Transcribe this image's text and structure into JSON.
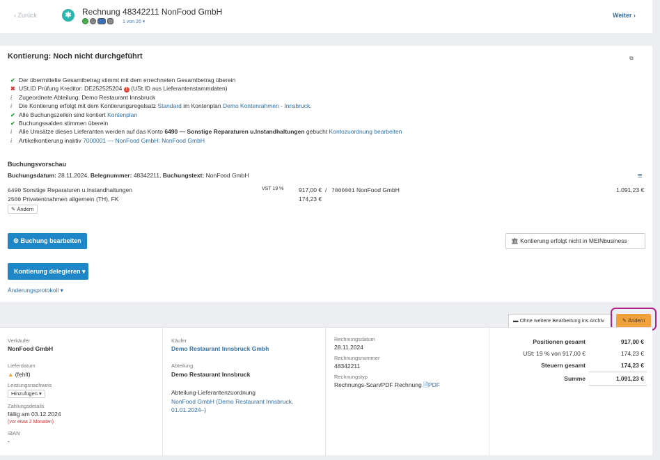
{
  "header": {
    "back_label": "‹ Zurück",
    "title": "Rechnung 48342211 NonFood GmbH",
    "counter": "1 von 26 ▾",
    "next_label": "Weiter ›"
  },
  "kontierung": {
    "title": "Kontierung: Noch nicht durchgeführt",
    "checks": [
      {
        "icon": "✔",
        "type": "ok",
        "text": "Der übermittelte Gesamtbetrag stimmt mit dem errechneten Gesamtbetrag überein"
      },
      {
        "icon": "✖",
        "type": "err",
        "text_a": "USt.ID Prüfung Kreditor: DE252525204",
        "text_b": "(USt.ID aus Lieferantenstammdaten)"
      },
      {
        "icon": "i",
        "type": "info",
        "text": "Zugeordnete Abteilung: Demo Restaurant Innsbruck"
      },
      {
        "icon": "i",
        "type": "info",
        "text_a": "Die Kontierung erfolgt mit dem Kontierungsregelsatz",
        "link_a": "Standard",
        "text_b": "im Kontenplan",
        "link_b": "Demo Kontenrahmen - Innsbruck",
        "text_c": "."
      },
      {
        "icon": "✔",
        "type": "ok",
        "text_a": "Alle Buchungszeilen sind kontiert",
        "link_a": "Kontenplan"
      },
      {
        "icon": "✔",
        "type": "ok",
        "text": "Buchungssalden stimmen überein"
      },
      {
        "icon": "i",
        "type": "info",
        "text_a": "Alle Umsätze dieses Lieferanten werden auf das Konto",
        "bold": "6490 — Sonstige Reparaturen u.Instandhaltungen",
        "text_b": "gebucht",
        "link_a": "Kontozuordnung bearbeiten"
      },
      {
        "icon": "i",
        "type": "info",
        "text_a": "Artikelkontierung inaktiv",
        "link_a": "7000001 — NonFood GmbH: NonFood GmbH"
      }
    ],
    "vorschau_title": "Buchungsvorschau",
    "meta": {
      "datum_label": "Buchungsdatum:",
      "datum": "28.11.2024,",
      "beleg_label": "Belegnummer:",
      "beleg": "48342211,",
      "text_label": "Buchungstext:",
      "text": "NonFood GmbH"
    },
    "rows": [
      {
        "konto": "6490",
        "name": "Sonstige Reparaturen u.Instandhaltungen",
        "vst": "VST 19 %",
        "betrag": "917,00 €",
        "sep": "/",
        "gegen_konto": "7000001",
        "gegen_name": "NonFood GmbH",
        "summe": "1.091,23 €"
      },
      {
        "konto": "2500",
        "name": "Privatentnahmen allgemein (TH), FK",
        "betrag": "174,23 €"
      }
    ],
    "aendern_small": "✎ Ändern",
    "btn_bearbeiten": "Buchung bearbeiten",
    "btn_mein": "Kontierung erfolgt nicht in MEINbusiness",
    "btn_delegieren": "Kontierung delegieren ▾",
    "protokoll": "Änderungsprotokoll ▾"
  },
  "actions": {
    "archiv": "Ohne weitere Bearbeitung ins Archiv",
    "aendern": "✎ Ändern"
  },
  "details": {
    "verkaeufer_label": "Verkäufer",
    "verkaeufer": "NonFood GmbH",
    "lieferdatum_label": "Lieferdatum",
    "lieferdatum": "(fehlt)",
    "leistung_label": "Leistungsnachweis",
    "leistung_select": "Hinzufügen ▾",
    "zahlung_label": "Zahlungsdetails",
    "zahlung": "fällig am 03.12.2024",
    "zahlung_hint": "(vor etwa 2 Monaten)",
    "iban_label": "IBAN",
    "iban": "-",
    "kaeufer_label": "Käufer",
    "kaeufer": "Demo Restaurant Innsbruck Gmbh",
    "abteilung_label": "Abteilung",
    "abteilung": "Demo Restaurant Innsbruck",
    "zuordnung_label": "Abteilung-Lieferantenzuordnung",
    "zuordnung_1": "NonFood GmbH (Demo Restaurant Innsbruck,",
    "zuordnung_2": "01.01.2024–)",
    "rdatum_label": "Rechnungsdatum",
    "rdatum": "28.11.2024",
    "rnummer_label": "Rechnungsnummer",
    "rnummer": "48342211",
    "rtyp_label": "Rechnungstyp",
    "rtyp": "Rechnungs-Scan/PDF Rechnung",
    "rtyp_link": "PDF"
  },
  "summary": {
    "pos_label": "Positionen gesamt",
    "pos": "917,00 €",
    "ust_label": "USt: 19 % von 917,00 €",
    "ust": "174,23 €",
    "steuern_label": "Steuern gesamt",
    "steuern": "174,23 €",
    "summe_label": "Summe",
    "summe": "1.091,23 €"
  }
}
